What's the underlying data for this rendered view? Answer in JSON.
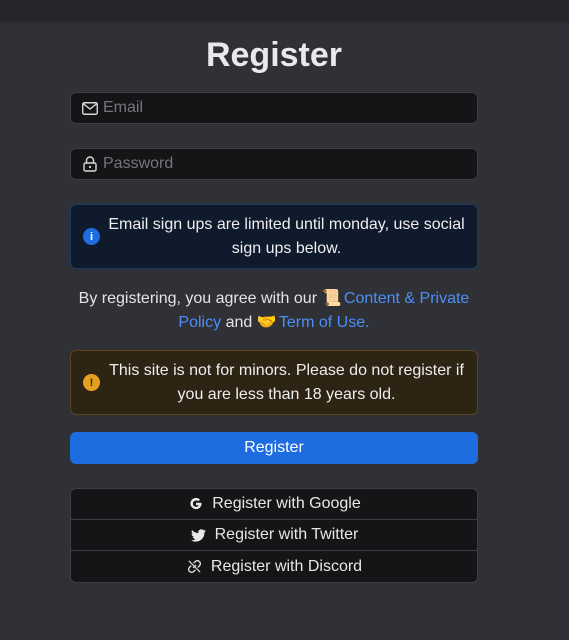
{
  "page": {
    "title": "Register"
  },
  "form": {
    "email": {
      "placeholder": "Email",
      "value": "",
      "icon": "envelope-icon"
    },
    "password": {
      "placeholder": "Password",
      "value": "",
      "icon": "lock-icon"
    }
  },
  "alerts": {
    "info": {
      "text": "Email sign ups are limited until monday, use social sign ups below.",
      "icon": "info-icon",
      "icon_glyph": "i",
      "color": "#1d6ce0"
    },
    "warning": {
      "text": "This site is not for minors. Please do not register if you are less than 18 years old.",
      "icon": "exclamation-icon",
      "icon_glyph": "!",
      "color": "#e6a01f"
    }
  },
  "terms": {
    "prefix": "By registering, you agree with our",
    "emoji_1": "📜",
    "link_1": "Content & Private Policy",
    "middle": "and",
    "emoji_2": "🤝",
    "link_2": "Term of Use."
  },
  "buttons": {
    "register": "Register"
  },
  "social": [
    {
      "label": "Register with Google",
      "icon": "google-icon"
    },
    {
      "label": "Register with Twitter",
      "icon": "twitter-icon"
    },
    {
      "label": "Register with Discord",
      "icon": "link-icon"
    }
  ],
  "colors": {
    "background": "#2f3136",
    "primary": "#1d6ce0",
    "link": "#4c8ef7",
    "info": "#1d6ce0",
    "warning": "#e6a01f"
  }
}
